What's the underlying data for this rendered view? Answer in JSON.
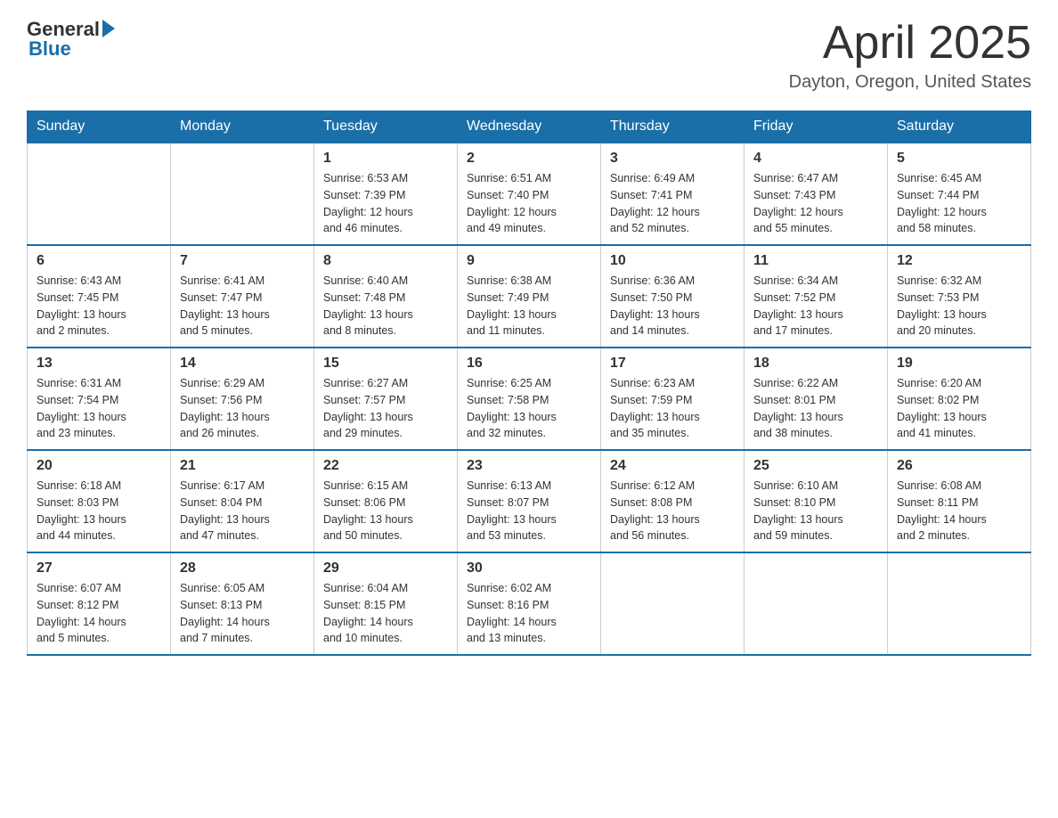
{
  "header": {
    "logo_general": "General",
    "logo_blue": "Blue",
    "month_title": "April 2025",
    "location": "Dayton, Oregon, United States"
  },
  "days_of_week": [
    "Sunday",
    "Monday",
    "Tuesday",
    "Wednesday",
    "Thursday",
    "Friday",
    "Saturday"
  ],
  "weeks": [
    [
      {
        "day": "",
        "info": ""
      },
      {
        "day": "",
        "info": ""
      },
      {
        "day": "1",
        "info": "Sunrise: 6:53 AM\nSunset: 7:39 PM\nDaylight: 12 hours\nand 46 minutes."
      },
      {
        "day": "2",
        "info": "Sunrise: 6:51 AM\nSunset: 7:40 PM\nDaylight: 12 hours\nand 49 minutes."
      },
      {
        "day": "3",
        "info": "Sunrise: 6:49 AM\nSunset: 7:41 PM\nDaylight: 12 hours\nand 52 minutes."
      },
      {
        "day": "4",
        "info": "Sunrise: 6:47 AM\nSunset: 7:43 PM\nDaylight: 12 hours\nand 55 minutes."
      },
      {
        "day": "5",
        "info": "Sunrise: 6:45 AM\nSunset: 7:44 PM\nDaylight: 12 hours\nand 58 minutes."
      }
    ],
    [
      {
        "day": "6",
        "info": "Sunrise: 6:43 AM\nSunset: 7:45 PM\nDaylight: 13 hours\nand 2 minutes."
      },
      {
        "day": "7",
        "info": "Sunrise: 6:41 AM\nSunset: 7:47 PM\nDaylight: 13 hours\nand 5 minutes."
      },
      {
        "day": "8",
        "info": "Sunrise: 6:40 AM\nSunset: 7:48 PM\nDaylight: 13 hours\nand 8 minutes."
      },
      {
        "day": "9",
        "info": "Sunrise: 6:38 AM\nSunset: 7:49 PM\nDaylight: 13 hours\nand 11 minutes."
      },
      {
        "day": "10",
        "info": "Sunrise: 6:36 AM\nSunset: 7:50 PM\nDaylight: 13 hours\nand 14 minutes."
      },
      {
        "day": "11",
        "info": "Sunrise: 6:34 AM\nSunset: 7:52 PM\nDaylight: 13 hours\nand 17 minutes."
      },
      {
        "day": "12",
        "info": "Sunrise: 6:32 AM\nSunset: 7:53 PM\nDaylight: 13 hours\nand 20 minutes."
      }
    ],
    [
      {
        "day": "13",
        "info": "Sunrise: 6:31 AM\nSunset: 7:54 PM\nDaylight: 13 hours\nand 23 minutes."
      },
      {
        "day": "14",
        "info": "Sunrise: 6:29 AM\nSunset: 7:56 PM\nDaylight: 13 hours\nand 26 minutes."
      },
      {
        "day": "15",
        "info": "Sunrise: 6:27 AM\nSunset: 7:57 PM\nDaylight: 13 hours\nand 29 minutes."
      },
      {
        "day": "16",
        "info": "Sunrise: 6:25 AM\nSunset: 7:58 PM\nDaylight: 13 hours\nand 32 minutes."
      },
      {
        "day": "17",
        "info": "Sunrise: 6:23 AM\nSunset: 7:59 PM\nDaylight: 13 hours\nand 35 minutes."
      },
      {
        "day": "18",
        "info": "Sunrise: 6:22 AM\nSunset: 8:01 PM\nDaylight: 13 hours\nand 38 minutes."
      },
      {
        "day": "19",
        "info": "Sunrise: 6:20 AM\nSunset: 8:02 PM\nDaylight: 13 hours\nand 41 minutes."
      }
    ],
    [
      {
        "day": "20",
        "info": "Sunrise: 6:18 AM\nSunset: 8:03 PM\nDaylight: 13 hours\nand 44 minutes."
      },
      {
        "day": "21",
        "info": "Sunrise: 6:17 AM\nSunset: 8:04 PM\nDaylight: 13 hours\nand 47 minutes."
      },
      {
        "day": "22",
        "info": "Sunrise: 6:15 AM\nSunset: 8:06 PM\nDaylight: 13 hours\nand 50 minutes."
      },
      {
        "day": "23",
        "info": "Sunrise: 6:13 AM\nSunset: 8:07 PM\nDaylight: 13 hours\nand 53 minutes."
      },
      {
        "day": "24",
        "info": "Sunrise: 6:12 AM\nSunset: 8:08 PM\nDaylight: 13 hours\nand 56 minutes."
      },
      {
        "day": "25",
        "info": "Sunrise: 6:10 AM\nSunset: 8:10 PM\nDaylight: 13 hours\nand 59 minutes."
      },
      {
        "day": "26",
        "info": "Sunrise: 6:08 AM\nSunset: 8:11 PM\nDaylight: 14 hours\nand 2 minutes."
      }
    ],
    [
      {
        "day": "27",
        "info": "Sunrise: 6:07 AM\nSunset: 8:12 PM\nDaylight: 14 hours\nand 5 minutes."
      },
      {
        "day": "28",
        "info": "Sunrise: 6:05 AM\nSunset: 8:13 PM\nDaylight: 14 hours\nand 7 minutes."
      },
      {
        "day": "29",
        "info": "Sunrise: 6:04 AM\nSunset: 8:15 PM\nDaylight: 14 hours\nand 10 minutes."
      },
      {
        "day": "30",
        "info": "Sunrise: 6:02 AM\nSunset: 8:16 PM\nDaylight: 14 hours\nand 13 minutes."
      },
      {
        "day": "",
        "info": ""
      },
      {
        "day": "",
        "info": ""
      },
      {
        "day": "",
        "info": ""
      }
    ]
  ]
}
